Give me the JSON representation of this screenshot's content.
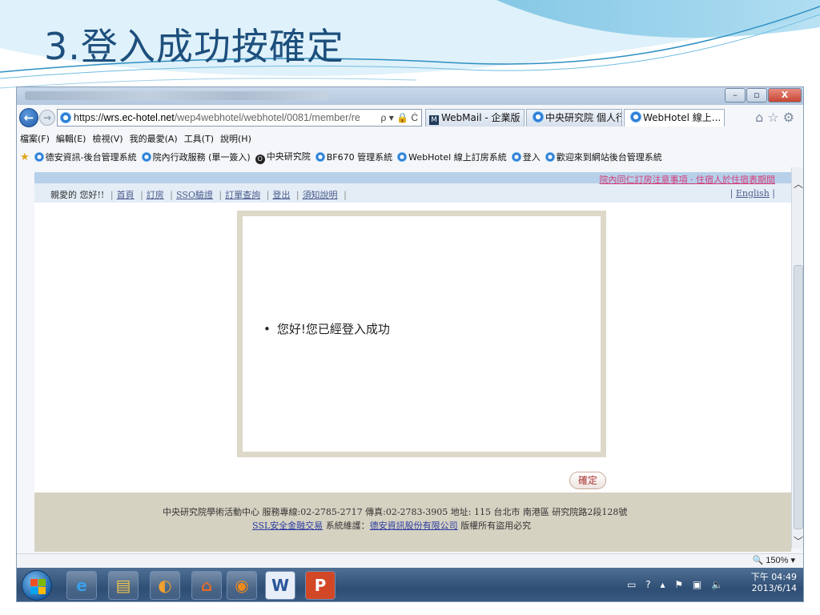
{
  "slide": {
    "title": "3.登入成功按確定"
  },
  "browser": {
    "nav": {
      "back_glyph": "←",
      "forward_glyph": "→"
    },
    "address": {
      "prefix": "https://",
      "host": "wrs.ec-hotel.net",
      "path": "/wep4webhotel/webhotel/0081/member/re",
      "icons": "ρ ▾ 🔒 Ċ"
    },
    "tabs": [
      {
        "label": "WebMail - 企業版"
      },
      {
        "label": "中央研究院 個人行..."
      },
      {
        "label": "WebHotel 線上...",
        "close": "×"
      }
    ],
    "right_icons": "⌂☆⚙",
    "window_buttons": {
      "minimize": "–",
      "maximize": "▫",
      "close": "X"
    },
    "menu": [
      "檔案(F)",
      "編輯(E)",
      "檢視(V)",
      "我的最愛(A)",
      "工具(T)",
      "說明(H)"
    ],
    "favorites": [
      "德安資訊-後台管理系統",
      "院內行政服務 (單一簽入)",
      "中央研究院",
      "BF670 管理系統",
      "WebHotel 線上訂房系統",
      "登入",
      "歡迎來到網站後台管理系統"
    ],
    "zoom": "150%",
    "zoom_arrow": "▾"
  },
  "page": {
    "notice": "院內同仁訂房注意事項 · 住宿人於住宿表期間",
    "greeting": "親愛的 您好!!",
    "nav_links": [
      "首頁",
      "訂房",
      "SSO驗證",
      "訂單查詢",
      "登出",
      "須知說明"
    ],
    "english": "English",
    "message": "您好!您已經登入成功",
    "ok_button": "確定",
    "footer": {
      "line1": "中央研究院學術活動中心   服務專線:02-2785-2717   傳真:02-2783-3905   地址: 115 台北市 南港區 研究院路2段128號",
      "ssl_link": "SSL安全金融交易",
      "maintenance_label": "系統維護：",
      "company_link": "德安資訊股份有限公司",
      "copyright": "版權所有盜用必究"
    }
  },
  "taskbar": {
    "icons": [
      "ie-icon",
      "folder-icon",
      "outlook-icon",
      "home-icon",
      "firefox-icon",
      "word-icon",
      "powerpoint-icon"
    ],
    "word_letter": "W",
    "ppt_letter": "P",
    "time": "下午 04:49",
    "date": "2013/6/14",
    "tray_icons": "▭ ? ▴ ⚑ ▣ 🔈"
  },
  "colors": {
    "title": "#1d4f7c",
    "page_header": "#e4edf6",
    "footer_bg": "#d6d2c2",
    "notice_link": "#d43c78",
    "taskbar": "#2f4e74"
  }
}
